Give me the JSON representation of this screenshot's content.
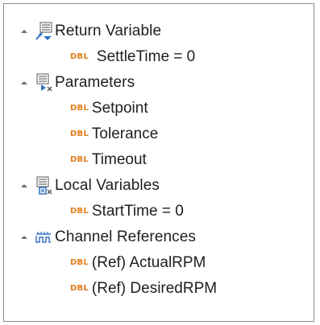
{
  "tree": {
    "groups": [
      {
        "label": "Return Variable",
        "icon": "return-variable-icon",
        "expanded": true,
        "children": [
          {
            "type": "DBL",
            "label": "SettleTime = 0"
          }
        ]
      },
      {
        "label": "Parameters",
        "icon": "parameters-icon",
        "expanded": true,
        "children": [
          {
            "type": "DBL",
            "label": "Setpoint"
          },
          {
            "type": "DBL",
            "label": "Tolerance"
          },
          {
            "type": "DBL",
            "label": "Timeout"
          }
        ]
      },
      {
        "label": "Local Variables",
        "icon": "local-variables-icon",
        "expanded": true,
        "children": [
          {
            "type": "DBL",
            "label": "StartTime = 0"
          }
        ]
      },
      {
        "label": "Channel References",
        "icon": "channel-references-icon",
        "expanded": true,
        "children": [
          {
            "type": "DBL",
            "label": "(Ref) ActualRPM"
          },
          {
            "type": "DBL",
            "label": "(Ref) DesiredRPM"
          }
        ]
      }
    ]
  },
  "colors": {
    "badge": "#e07c1a",
    "text": "#1e1e1e",
    "icon_blue": "#2f6fc4",
    "border": "#8a8a8a"
  }
}
